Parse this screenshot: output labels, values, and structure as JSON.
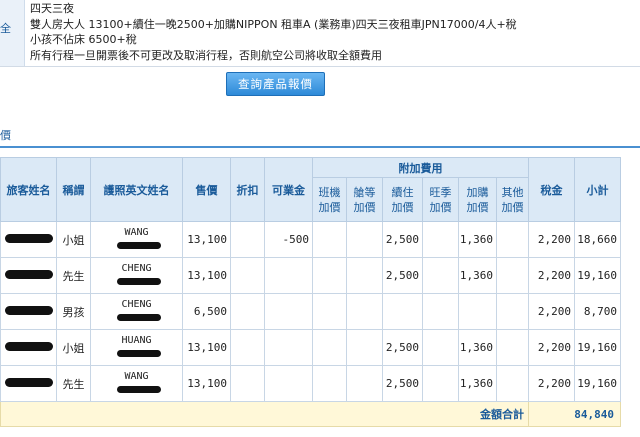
{
  "info": {
    "side_label": "全",
    "lines": [
      "四天三夜",
      "雙人房大人 13100+續住一晚2500+加購NIPPON 租車A (業務車)四天三夜租車JPN17000/4人+稅",
      "小孩不佔床 6500+稅",
      "所有行程一旦開票後不可更改及取消行程，否則航空公司將收取全額費用"
    ]
  },
  "buttons": {
    "query_price": "查詢產品報價"
  },
  "side_link": "價",
  "table": {
    "headers": {
      "name": "旅客姓名",
      "title": "稱謂",
      "passport_name": "護照英文姓名",
      "price": "售價",
      "discount": "折扣",
      "deductible": "可業金",
      "extra_group": "附加費用",
      "tax": "稅金",
      "subtotal": "小計"
    },
    "extra_headers": [
      "班機\n加價",
      "艙等\n加價",
      "續住\n加價",
      "旺季\n加價",
      "加購\n加價",
      "其他\n加價"
    ],
    "rows": [
      {
        "title": "小姐",
        "surname": "WANG",
        "price": "13,100",
        "deductible": "-500",
        "extend": "2,500",
        "addon": "1,360",
        "tax": "2,200",
        "subtotal": "18,660"
      },
      {
        "title": "先生",
        "surname": "CHENG",
        "price": "13,100",
        "deductible": "",
        "extend": "2,500",
        "addon": "1,360",
        "tax": "2,200",
        "subtotal": "19,160"
      },
      {
        "title": "男孩",
        "surname": "CHENG",
        "price": "6,500",
        "deductible": "",
        "extend": "",
        "addon": "",
        "tax": "2,200",
        "subtotal": "8,700"
      },
      {
        "title": "小姐",
        "surname": "HUANG",
        "price": "13,100",
        "deductible": "",
        "extend": "2,500",
        "addon": "1,360",
        "tax": "2,200",
        "subtotal": "19,160"
      },
      {
        "title": "先生",
        "surname": "WANG",
        "price": "13,100",
        "deductible": "",
        "extend": "2,500",
        "addon": "1,360",
        "tax": "2,200",
        "subtotal": "19,160"
      }
    ],
    "total_label": "金額合計",
    "total_value": "84,840"
  }
}
